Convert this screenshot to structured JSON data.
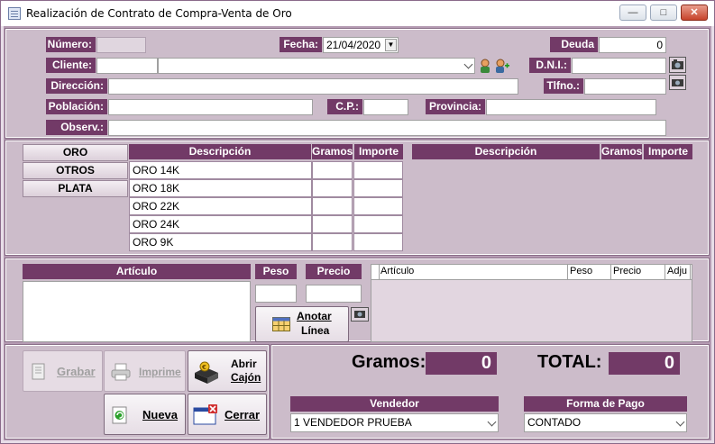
{
  "window": {
    "title": "Realización de Contrato de Compra-Venta de Oro"
  },
  "titlebar_buttons": {
    "minimize": "—",
    "maximize": "□",
    "close": "✕"
  },
  "header": {
    "numero_label": "Número:",
    "numero_value": "",
    "fecha_label": "Fecha:",
    "fecha_value": "21/04/2020",
    "deuda_label": "Deuda",
    "deuda_value": "0",
    "cliente_label": "Cliente:",
    "cliente_code": "",
    "cliente_name": "",
    "dni_label": "D.N.I.:",
    "dni_value": "",
    "direccion_label": "Dirección:",
    "direccion_value": "",
    "tlfno_label": "Tlfno.:",
    "tlfno_value": "",
    "poblacion_label": "Población:",
    "poblacion_value": "",
    "cp_label": "C.P.:",
    "cp_value": "",
    "provincia_label": "Provincia:",
    "provincia_value": "",
    "observ_label": "Observ.:",
    "observ_value": ""
  },
  "categories": [
    "ORO",
    "OTROS",
    "PLATA"
  ],
  "products_table": {
    "headers": [
      "Descripción",
      "Gramos",
      "Importe"
    ],
    "rows": [
      {
        "descripcion": "ORO 14K",
        "gramos": "",
        "importe": ""
      },
      {
        "descripcion": "ORO 18K",
        "gramos": "",
        "importe": ""
      },
      {
        "descripcion": "ORO 22K",
        "gramos": "",
        "importe": ""
      },
      {
        "descripcion": "ORO 24K",
        "gramos": "",
        "importe": ""
      },
      {
        "descripcion": "ORO 9K",
        "gramos": "",
        "importe": ""
      }
    ]
  },
  "products_table_right": {
    "headers": [
      "Descripción",
      "Gramos",
      "Importe"
    ]
  },
  "article_entry": {
    "articulo_label": "Artículo",
    "peso_label": "Peso",
    "precio_label": "Precio",
    "peso_value": "",
    "precio_value": "",
    "anotar_label_1": "Anotar",
    "anotar_label_2": "Línea"
  },
  "lines_grid": {
    "headers": [
      "Artículo",
      "Peso",
      "Precio",
      "Adju"
    ]
  },
  "actions": {
    "grabar": "Grabar",
    "imprime": "Imprime",
    "abrir_cajon_1": "Abrir",
    "abrir_cajon_2": "Cajón",
    "nueva": "Nueva",
    "cerrar": "Cerrar"
  },
  "totals": {
    "gramos_label": "Gramos:",
    "gramos_value": "0",
    "total_label": "TOTAL:",
    "total_value": "0"
  },
  "vendedor": {
    "label": "Vendedor",
    "value": "1 VENDEDOR PRUEBA"
  },
  "forma_pago": {
    "label": "Forma de Pago",
    "value": "CONTADO"
  },
  "colors": {
    "accent": "#723a67",
    "panel": "#ccbcca",
    "frame": "#b59bb3"
  }
}
